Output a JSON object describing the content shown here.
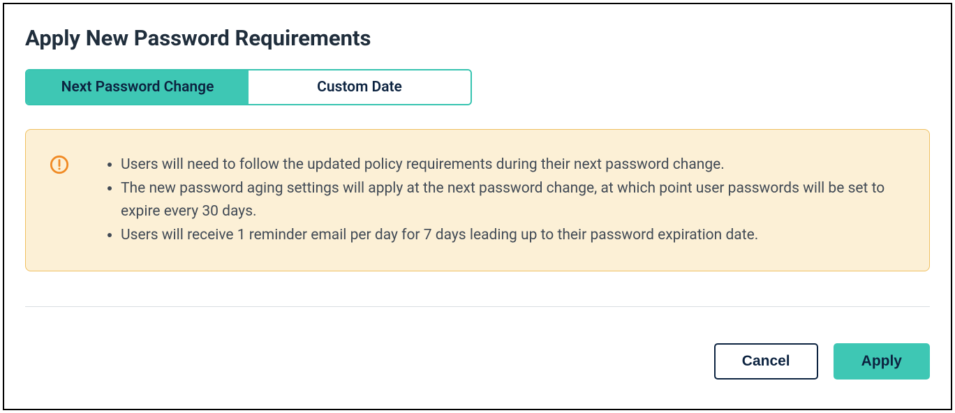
{
  "modal": {
    "title": "Apply New Password Requirements"
  },
  "tabs": {
    "next": "Next Password Change",
    "custom": "Custom Date"
  },
  "alert": {
    "items": [
      "Users will need to follow the updated policy requirements during their next password change.",
      "The new password aging settings will apply at the next password change, at which point user passwords will be set to expire every 30 days.",
      "Users will receive 1 reminder email per day for 7 days leading up to their password expiration date."
    ]
  },
  "footer": {
    "cancel": "Cancel",
    "apply": "Apply"
  }
}
